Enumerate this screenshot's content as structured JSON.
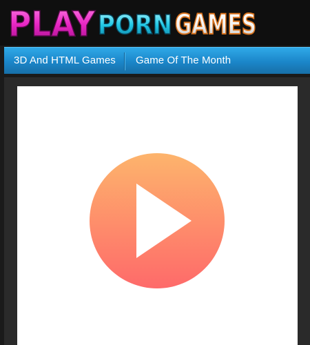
{
  "header": {
    "logo": {
      "part1": "PLAY",
      "part2": "PORN",
      "part3": "GAMES"
    }
  },
  "nav": {
    "items": [
      {
        "label": "3D And HTML Games"
      },
      {
        "label": "Game Of The Month"
      }
    ]
  },
  "player": {
    "play_icon": "play-icon",
    "colors": {
      "gradient_top": "#fdb46c",
      "gradient_bottom": "#fe6a6a",
      "nav_blue": "#1b86c9"
    }
  }
}
